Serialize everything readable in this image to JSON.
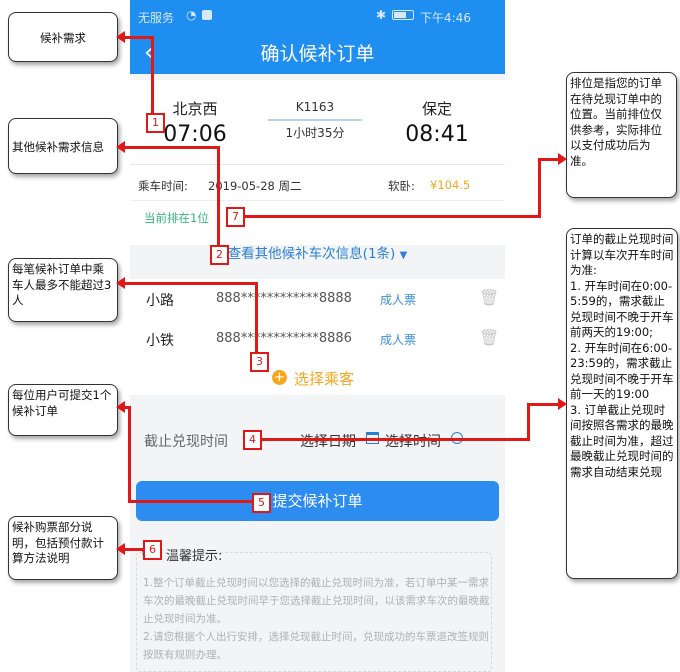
{
  "status_bar": {
    "left": "无服务",
    "right": "下午4:46"
  },
  "header": {
    "title": "确认候补订单"
  },
  "train": {
    "from_station": "北京西",
    "depart_time": "07:06",
    "train_no": "K1163",
    "duration": "1小时35分",
    "to_station": "保定",
    "arrive_time": "08:41"
  },
  "ride": {
    "date_label": "乘车时间:",
    "date_value": "2019-05-28 周二",
    "seat_label": "软卧:",
    "price": "¥104.5"
  },
  "queue_text": "当前排在1位",
  "other_trains_link": "查看其他候补车次信息(1条)",
  "passengers": [
    {
      "name": "小路",
      "id": "888************8888",
      "type": "成人票"
    },
    {
      "name": "小铁",
      "id": "888************8886",
      "type": "成人票"
    }
  ],
  "choose_passenger": "选择乘客",
  "deadline": {
    "label": "截止兑现时间",
    "date_btn": "选择日期",
    "time_btn": "选择时间"
  },
  "submit_label": "提交候补订单",
  "tips": {
    "title": "温馨提示:",
    "p1": "1.整个订单截止兑现时间以您选择的截止兑现时间为准，若订单中某一需求车次的最晚截止兑现时间早于您选择截止兑现时间，以该需求车次的最晚截止兑现时间为准。",
    "p2": "2.请您根据个人出行安排，选择兑现截止时间，兑现成功的车票退改签规则按既有规则办理。"
  },
  "callouts": {
    "c_need": "候补需求",
    "c_other": "其他候补需求信息",
    "c_max": "每笔候补订单中乘车人最多不能超过3人",
    "c_user": "每位用户可提交1个候补订单",
    "c_explain": "候补购票部分说明，包括预付款计算方法说明",
    "c_rank": "排位是指您的订单在待兑现订单中的位置。当前排位仅供参考，实际排位以支付成功后为准。",
    "c_deadline": "订单的截止兑现时间计算以车次开车时间为准:\n1. 开车时间在0:00-5:59的，需求截止兑现时间不晚于开车前两天的19:00;\n2. 开车时间在6:00-23:59的，需求截止兑现时间不晚于开车前一天的19:00\n3. 订单截止兑现时间按照各需求的最晚截止时间为准，超过最晚截止兑现时间的需求自动结束兑现"
  },
  "markers": [
    "1",
    "2",
    "3",
    "4",
    "5",
    "6",
    "7"
  ],
  "colors": {
    "primary": "#1e8ef0",
    "price": "#f5a623",
    "annotation": "#e01818"
  }
}
